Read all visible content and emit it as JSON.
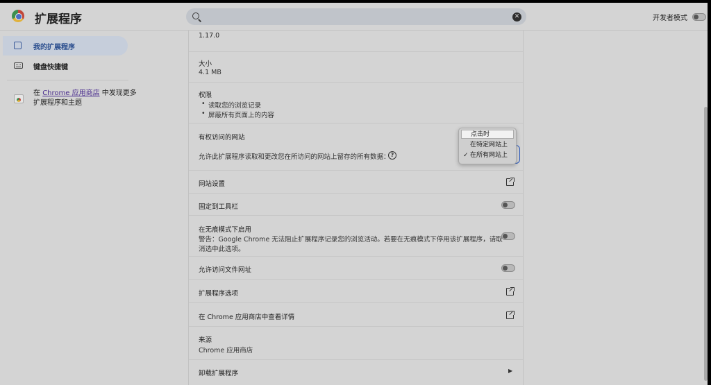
{
  "header": {
    "title": "扩展程序",
    "search_placeholder": "",
    "dev_mode_label": "开发者模式"
  },
  "sidebar": {
    "items": [
      {
        "label": "我的扩展程序",
        "active": true
      },
      {
        "label": "键盘快捷键",
        "active": false
      }
    ],
    "store_prefix": "在",
    "store_link": "Chrome 应用商店",
    "store_suffix": "中发现更多扩展程序和主题"
  },
  "details": {
    "version": "1.17.0",
    "size_label": "大小",
    "size_value": "4.1 MB",
    "permissions_label": "权限",
    "permissions": [
      "读取您的浏览记录",
      "屏蔽所有页面上的内容"
    ],
    "site_access_label": "有权访问的网站",
    "site_access_desc": "允许此扩展程序读取和更改您在所访问的网站上留存的所有数据：",
    "site_access_options": [
      "点击时",
      "在特定网站上",
      "在所有网站上"
    ],
    "site_access_selected": "在所有网站上",
    "site_settings": "网站设置",
    "pin_toolbar": "固定到工具栏",
    "incognito_label": "在无痕模式下启用",
    "incognito_warning_1": "警告：Google Chrome 无法阻止扩展程序记录您的浏览活动。若要在无痕模式下停用该扩展程序，请取",
    "incognito_warning_2": "消选中此选项。",
    "file_urls": "允许访问文件网址",
    "ext_options": "扩展程序选项",
    "view_in_store": "在 Chrome 应用商店中查看详情",
    "source_label": "来源",
    "source_value": "Chrome 应用商店",
    "uninstall": "卸载扩展程序"
  },
  "colors": {
    "accent": "#2d5bbd",
    "bg": "#d4d4d4"
  }
}
